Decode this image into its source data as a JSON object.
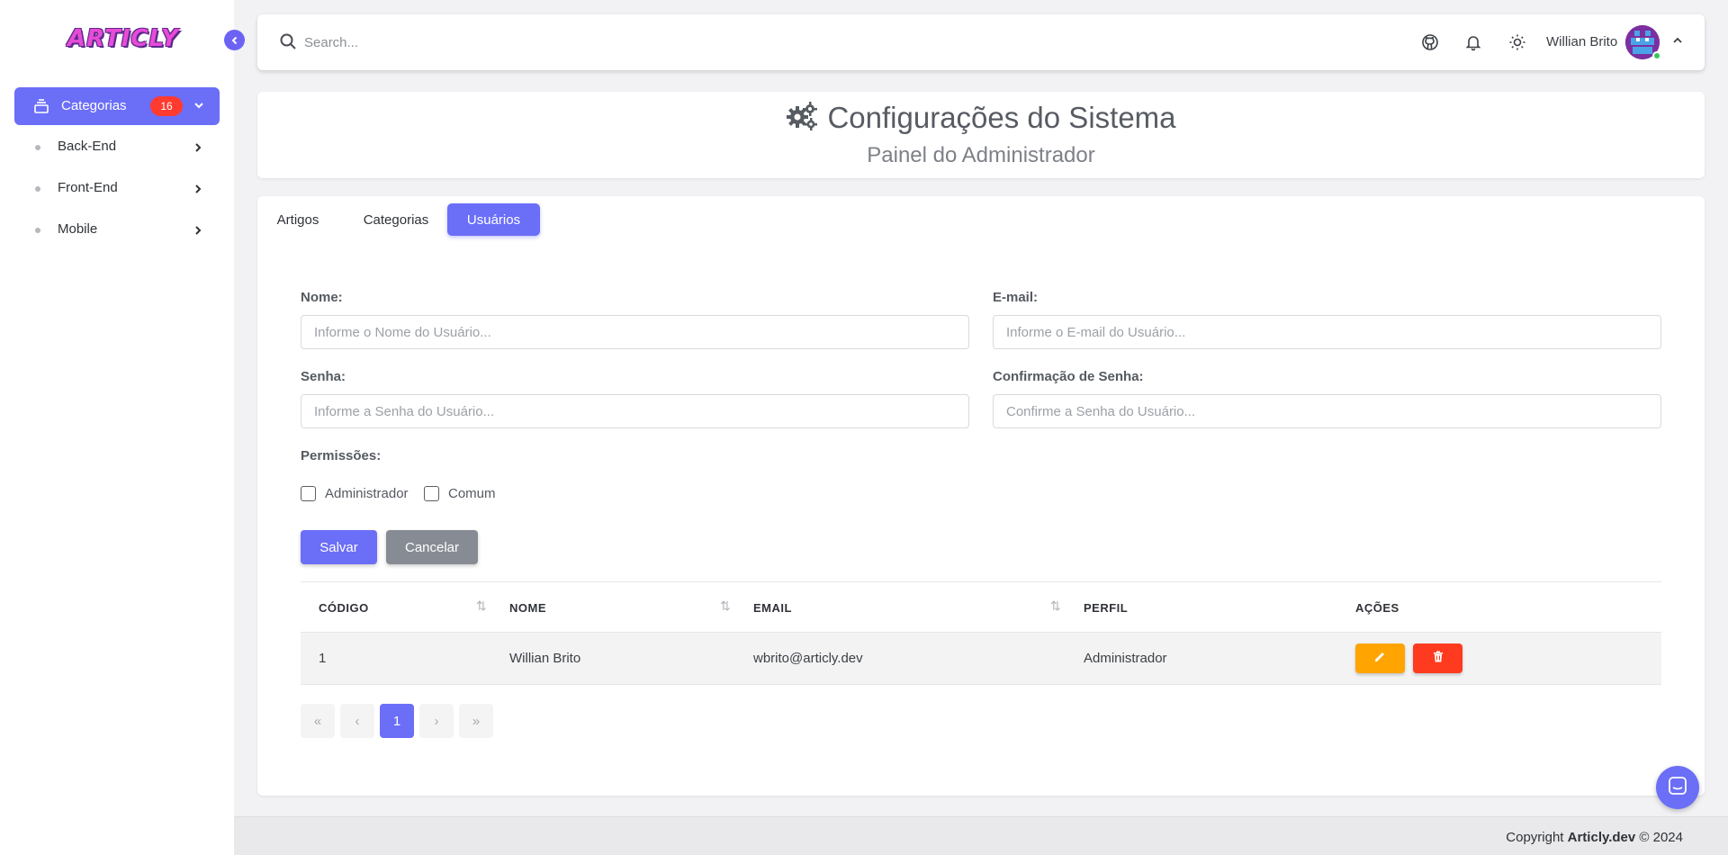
{
  "app": {
    "logo_text": "ARTICLY"
  },
  "sidebar": {
    "category": {
      "label": "Categorias",
      "badge": "16"
    },
    "items": [
      {
        "label": "Back-End"
      },
      {
        "label": "Front-End"
      },
      {
        "label": "Mobile"
      }
    ]
  },
  "topbar": {
    "search_placeholder": "Search...",
    "user_name": "Willian Brito"
  },
  "header": {
    "title": "Configurações do Sistema",
    "subtitle": "Painel do Administrador"
  },
  "tabs": [
    {
      "label": "Artigos"
    },
    {
      "label": "Categorias"
    },
    {
      "label": "Usuários",
      "active": true
    }
  ],
  "form": {
    "name_label": "Nome:",
    "name_placeholder": "Informe o Nome do Usuário...",
    "email_label": "E-mail:",
    "email_placeholder": "Informe o E-mail do Usuário...",
    "password_label": "Senha:",
    "password_placeholder": "Informe a Senha do Usuário...",
    "confirm_label": "Confirmação de Senha:",
    "confirm_placeholder": "Confirme a Senha do Usuário...",
    "permissions_label": "Permissões:",
    "perm_admin": "Administrador",
    "perm_common": "Comum",
    "save_label": "Salvar",
    "cancel_label": "Cancelar"
  },
  "table": {
    "columns": [
      "CÓDIGO",
      "NOME",
      "EMAIL",
      "PERFIL",
      "AÇÕES"
    ],
    "rows": [
      {
        "code": "1",
        "name": "Willian Brito",
        "email": "wbrito@articly.dev",
        "profile": "Administrador"
      }
    ]
  },
  "pagination": {
    "first": "«",
    "prev": "‹",
    "current": "1",
    "next": "›",
    "last": "»"
  },
  "footer": {
    "prefix": "Copyright ",
    "brand": "Articly.dev",
    "suffix": " © 2024"
  },
  "colors": {
    "primary": "#6b6ef7",
    "badge": "#ff3b30",
    "edit": "#ffa400",
    "delete": "#ff3b1f",
    "cancel": "#878c94"
  }
}
